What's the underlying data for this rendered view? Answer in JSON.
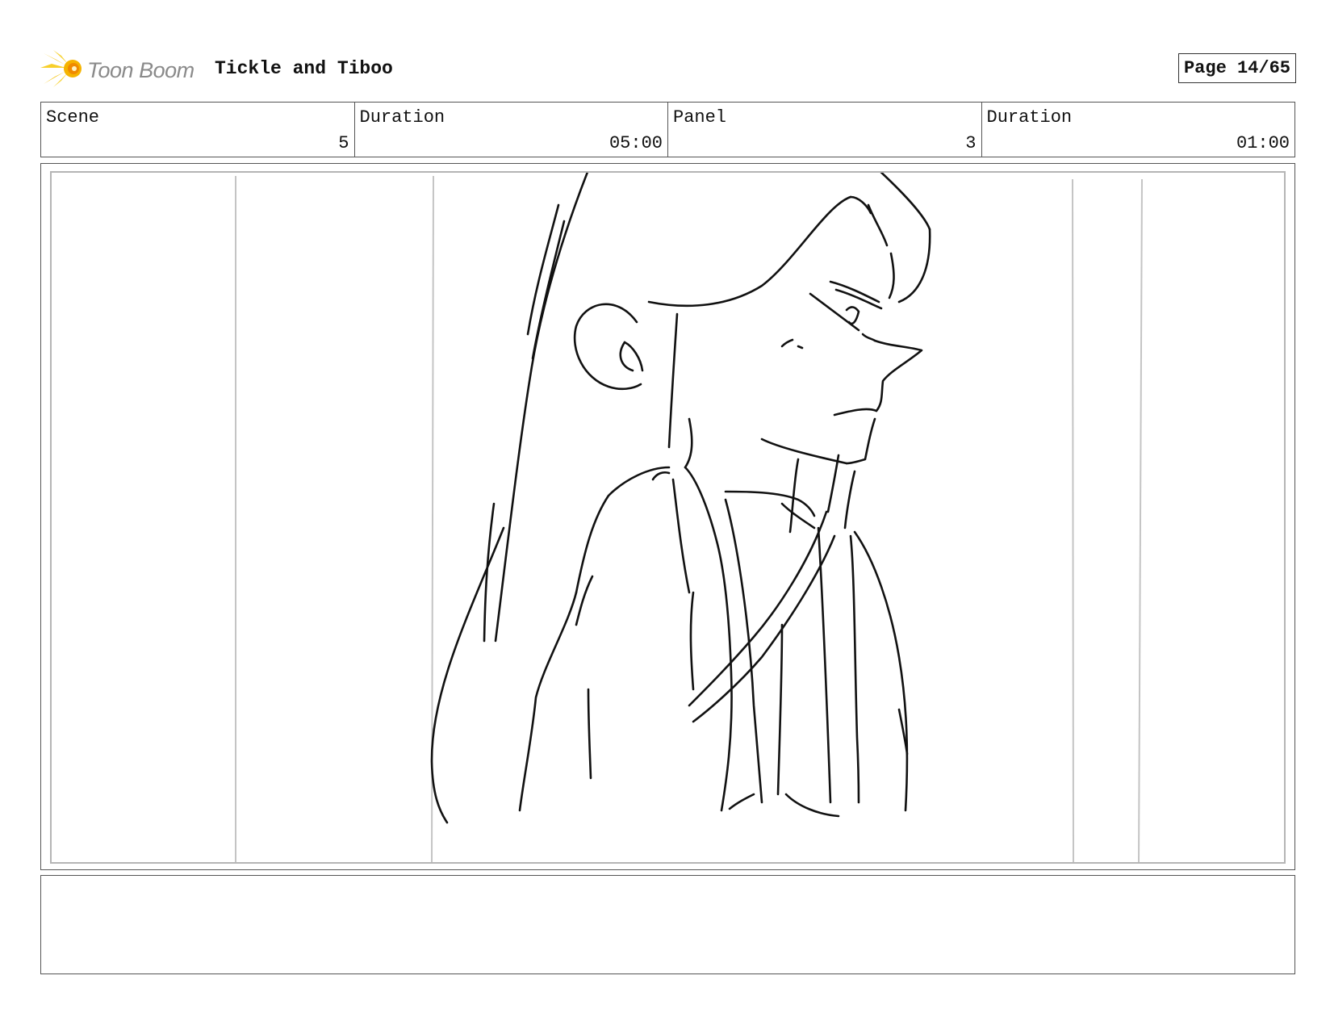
{
  "header": {
    "logo_text": "Toon Boom",
    "project_title": "Tickle and Tiboo",
    "page_label": "Page 14/65"
  },
  "info": {
    "scene_label": "Scene",
    "scene_value": "5",
    "scene_duration_label": "Duration",
    "scene_duration_value": "05:00",
    "panel_label": "Panel",
    "panel_value": "3",
    "panel_duration_label": "Duration",
    "panel_duration_value": "01:00"
  },
  "colors": {
    "logo_yellow": "#f5c000",
    "logo_orange": "#f08a00",
    "sketch_line": "#111111",
    "guide_line": "#c4c4c4"
  },
  "notes": {
    "action": ""
  }
}
